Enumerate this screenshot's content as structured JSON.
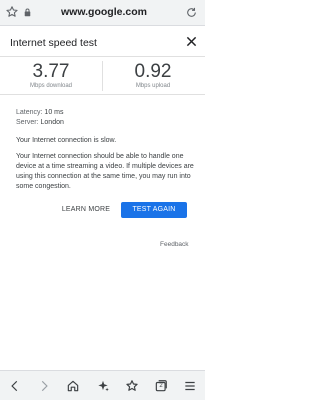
{
  "browser": {
    "url": "www.google.com",
    "tab_count": "2"
  },
  "widget": {
    "title": "Internet speed test"
  },
  "results": {
    "download_value": "3.77",
    "download_label": "Mbps download",
    "upload_value": "0.92",
    "upload_label": "Mbps upload"
  },
  "details": {
    "latency_label": "Latency:",
    "latency_value": "10 ms",
    "server_label": "Server:",
    "server_value": "London",
    "slow_message": "Your Internet connection is slow.",
    "description": "Your Internet connection should be able to handle one device at a time streaming a video. If multiple devices are using this connection at the same time, you may run into some congestion."
  },
  "actions": {
    "learn_more": "LEARN MORE",
    "test_again": "TEST AGAIN"
  },
  "footer": {
    "feedback": "Feedback"
  },
  "colors": {
    "accent": "#1a73e8",
    "text": "#202124",
    "muted": "#5f6368"
  }
}
